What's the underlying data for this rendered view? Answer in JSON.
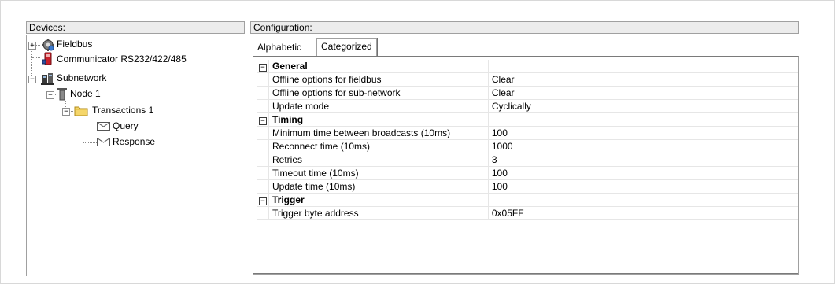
{
  "devices": {
    "header": "Devices:",
    "tree": [
      {
        "label": "Fieldbus",
        "icon": "fieldbus-icon",
        "expander": "+"
      },
      {
        "label": "Communicator RS232/422/485",
        "icon": "communicator-icon"
      },
      {
        "label": "Subnetwork",
        "icon": "subnetwork-icon",
        "expander": "−"
      },
      {
        "label": "Node 1",
        "icon": "node-icon",
        "expander": "−"
      },
      {
        "label": "Transactions 1",
        "icon": "folder-icon",
        "expander": "−"
      },
      {
        "label": "Query",
        "icon": "envelope-icon"
      },
      {
        "label": "Response",
        "icon": "envelope-icon"
      }
    ]
  },
  "configuration": {
    "header": "Configuration:",
    "tabs": [
      {
        "label": "Alphabetic"
      },
      {
        "label": "Categorized"
      }
    ],
    "active_tab": "Categorized",
    "categories": [
      {
        "name": "General",
        "rows": [
          {
            "name": "Offline options for fieldbus",
            "value": "Clear"
          },
          {
            "name": "Offline options for sub-network",
            "value": "Clear"
          },
          {
            "name": "Update mode",
            "value": "Cyclically"
          }
        ]
      },
      {
        "name": "Timing",
        "rows": [
          {
            "name": "Minimum time between broadcasts (10ms)",
            "value": "100"
          },
          {
            "name": "Reconnect time (10ms)",
            "value": "1000"
          },
          {
            "name": "Retries",
            "value": "3"
          },
          {
            "name": "Timeout time (10ms)",
            "value": "100"
          },
          {
            "name": "Update time (10ms)",
            "value": "100"
          }
        ]
      },
      {
        "name": "Trigger",
        "rows": [
          {
            "name": "Trigger byte address",
            "value": "0x05FF"
          }
        ]
      }
    ],
    "expander_symbol": "−"
  },
  "colors": {
    "header_bg": "#ececec",
    "border": "#a0a0a0",
    "grid_line": "#e6e6e6",
    "folder_yellow": "#f5d66a",
    "communicator_red": "#c8202a"
  }
}
